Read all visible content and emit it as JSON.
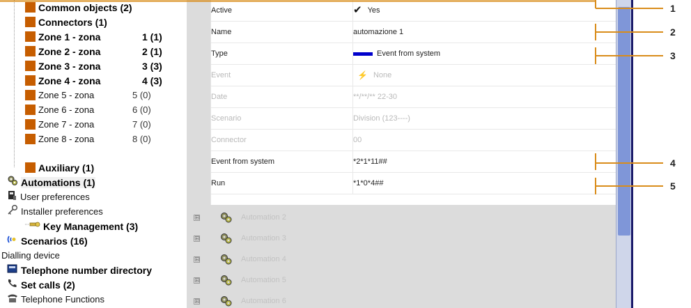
{
  "tree": {
    "items": [
      {
        "label": "Common objects (2)",
        "num": ""
      },
      {
        "label": "Connectors (1)",
        "num": ""
      },
      {
        "label": "Zone 1 - zona",
        "num": "1 (1)"
      },
      {
        "label": "Zone 2 - zona",
        "num": "2 (1)"
      },
      {
        "label": "Zone 3 - zona",
        "num": "3 (3)"
      },
      {
        "label": "Zone 4 - zona",
        "num": "4 (3)"
      },
      {
        "label": "Zone 5 - zona",
        "num": "5 (0)"
      },
      {
        "label": "Zone 6 - zona",
        "num": "6 (0)"
      },
      {
        "label": "Zone 7 - zona",
        "num": "7 (0)"
      },
      {
        "label": "Zone 8 - zona",
        "num": "8 (0)"
      },
      {
        "label": "Auxiliary (1)",
        "num": ""
      },
      {
        "label": "Automations (1)",
        "num": ""
      },
      {
        "label": "User preferences",
        "num": ""
      },
      {
        "label": "Installer preferences",
        "num": ""
      },
      {
        "label": "Key Management (3)",
        "num": ""
      },
      {
        "label": "Scenarios (16)",
        "num": ""
      },
      {
        "label": "Dialling device",
        "num": ""
      },
      {
        "label": "Telephone number directory",
        "num": ""
      },
      {
        "label": "Set calls (2)",
        "num": ""
      },
      {
        "label": "Telephone Functions",
        "num": ""
      }
    ]
  },
  "properties": [
    {
      "key": "Active",
      "value": "Yes"
    },
    {
      "key": "Name",
      "value": "automazione 1"
    },
    {
      "key": "Type",
      "value": "Event from system"
    },
    {
      "key": "Event",
      "value": "None"
    },
    {
      "key": "Date",
      "value": "**/**/** 22-30"
    },
    {
      "key": "Scenario",
      "value": "Division (123----)"
    },
    {
      "key": "Connector",
      "value": "00"
    },
    {
      "key": "Event from system",
      "value": "*2*1*11##"
    },
    {
      "key": "Run",
      "value": "*1*0*4##"
    }
  ],
  "automations": [
    {
      "label": "Automation 2"
    },
    {
      "label": "Automation 3"
    },
    {
      "label": "Automation 4"
    },
    {
      "label": "Automation 5"
    },
    {
      "label": "Automation 6"
    }
  ],
  "callouts": [
    "1",
    "2",
    "3",
    "4",
    "5"
  ],
  "icons": {
    "expand": "⊞",
    "check": "✔",
    "event": "⚡"
  },
  "colors": {
    "type_bar": "#0000cc",
    "zone_icon": "#f2a100",
    "scrollbar_thumb": "#7f96d8",
    "callout_line": "#d98c1a"
  }
}
